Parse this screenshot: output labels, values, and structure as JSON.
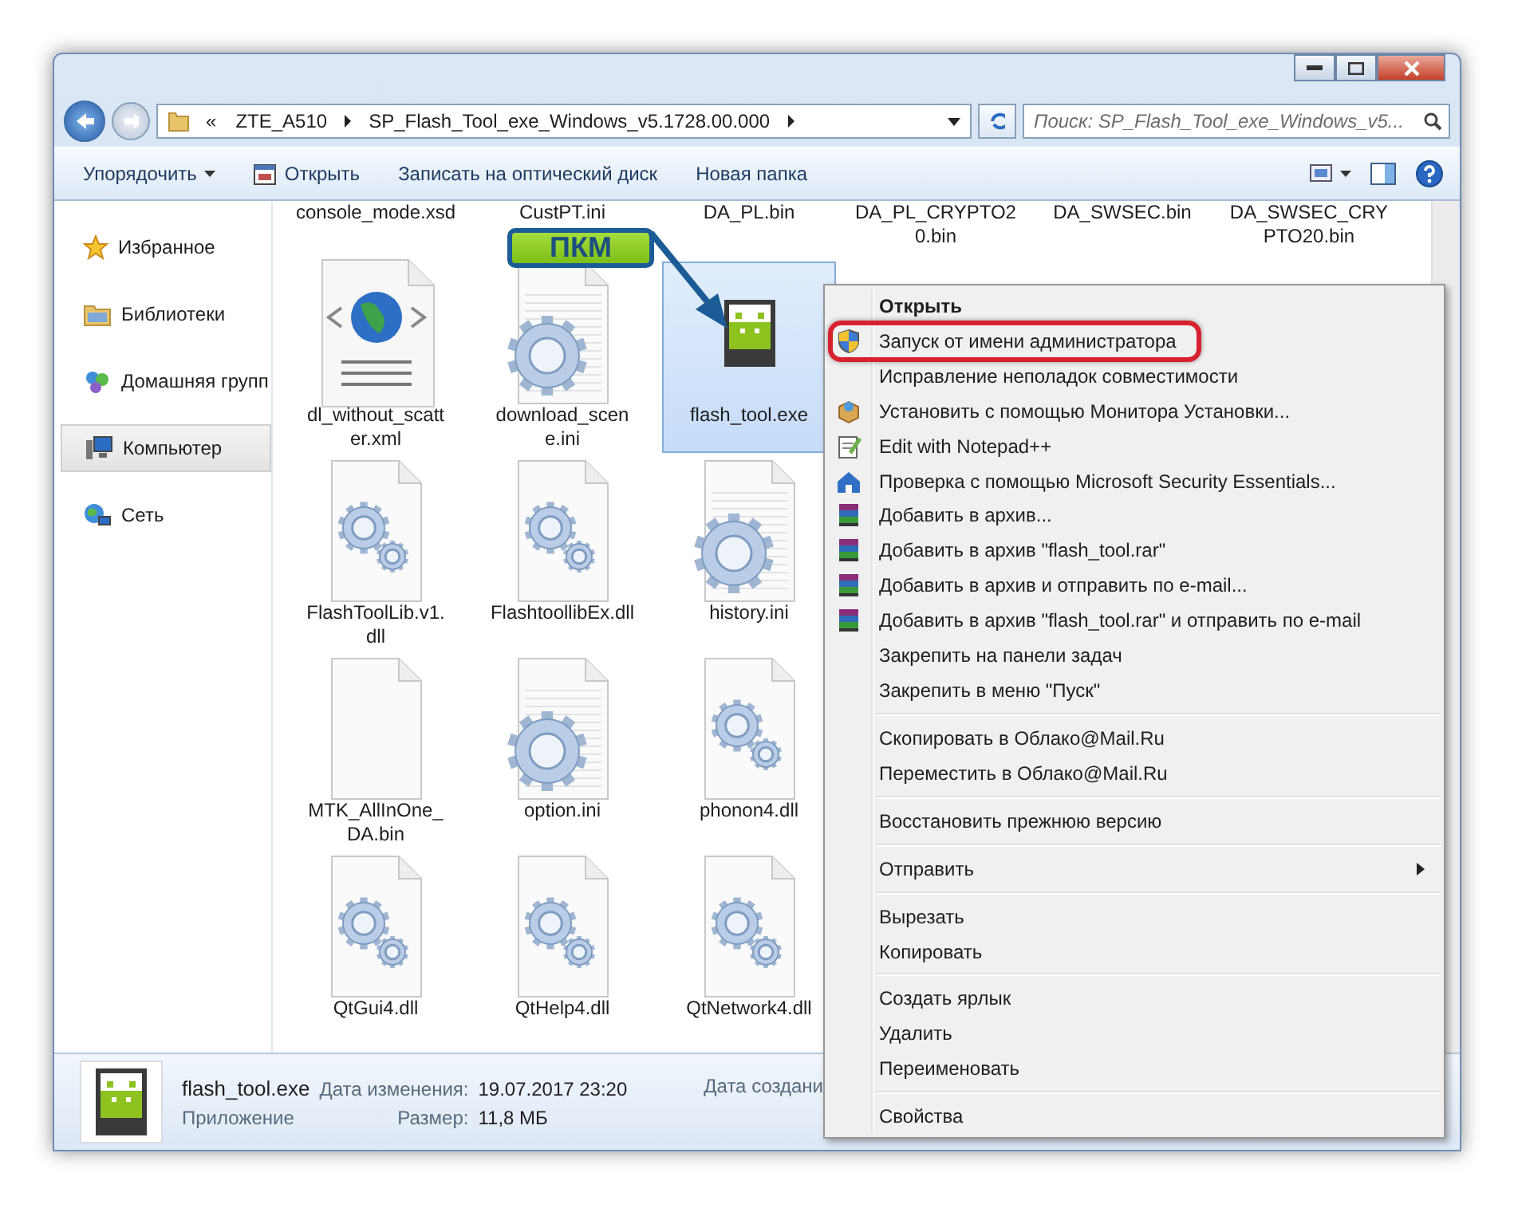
{
  "address_bar": {
    "overflow": "«",
    "crumbs": [
      "ZTE_A510",
      "SP_Flash_Tool_exe_Windows_v5.1728.00.000"
    ]
  },
  "search": {
    "placeholder": "Поиск: SP_Flash_Tool_exe_Windows_v5..."
  },
  "toolbar": {
    "items": [
      {
        "label": "Упорядочить",
        "kind": "menu"
      },
      {
        "label": "Открыть",
        "kind": "open"
      },
      {
        "label": "Записать на оптический диск",
        "kind": "plain"
      },
      {
        "label": "Новая папка",
        "kind": "plain"
      }
    ]
  },
  "sidebar": {
    "items": [
      {
        "label": "Избранное",
        "kind": "favorites",
        "selected": false
      },
      {
        "label": "Библиотеки",
        "kind": "libraries",
        "selected": false
      },
      {
        "label": "Домашняя групп",
        "kind": "homegroup",
        "selected": false
      },
      {
        "label": "Компьютер",
        "kind": "computer",
        "selected": true
      },
      {
        "label": "Сеть",
        "kind": "network",
        "selected": false
      }
    ]
  },
  "files": {
    "top_row": [
      "console_mode.xsd",
      "CustPT.ini",
      "DA_PL.bin",
      "DA_PL_CRYPTO20.bin",
      "DA_SWSEC.bin",
      "DA_SWSEC_CRYPTO20.bin"
    ],
    "items": [
      {
        "name": "dl_without_scatter.xml",
        "kind": "xml",
        "selected": false
      },
      {
        "name": "download_scene.ini",
        "kind": "settings",
        "selected": false
      },
      {
        "name": "flash_tool.exe",
        "kind": "exe",
        "selected": true
      },
      {
        "name": "FlashToolLib.v1.dll",
        "kind": "dll",
        "selected": false
      },
      {
        "name": "FlashtoollibEx.dll",
        "kind": "dll",
        "selected": false
      },
      {
        "name": "history.ini",
        "kind": "settings",
        "selected": false
      },
      {
        "name": "MTK_AllInOne_DA.bin",
        "kind": "blank",
        "selected": false
      },
      {
        "name": "option.ini",
        "kind": "settings",
        "selected": false
      },
      {
        "name": "phonon4.dll",
        "kind": "dll",
        "selected": false
      },
      {
        "name": "QtGui4.dll",
        "kind": "dll",
        "selected": false
      },
      {
        "name": "QtHelp4.dll",
        "kind": "dll",
        "selected": false
      },
      {
        "name": "QtNetwork4.dll",
        "kind": "dll",
        "selected": false
      }
    ]
  },
  "callout": {
    "label": "ПКМ"
  },
  "context_menu": [
    {
      "kind": "default",
      "label": "Открыть"
    },
    {
      "kind": "shielded",
      "label": "Запуск от имени администратора",
      "marked": true
    },
    {
      "kind": "item",
      "label": "Исправление неполадок совместимости"
    },
    {
      "kind": "installer",
      "label": "Установить с помощью Монитора Установки..."
    },
    {
      "kind": "editor",
      "label": "Edit with Notepad++"
    },
    {
      "kind": "antivirus",
      "label": "Проверка с помощью Microsoft Security Essentials..."
    },
    {
      "kind": "archiver",
      "label": "Добавить в архив..."
    },
    {
      "kind": "archiver",
      "label": "Добавить в архив \"flash_tool.rar\""
    },
    {
      "kind": "archiver",
      "label": "Добавить в архив и отправить по e-mail..."
    },
    {
      "kind": "archiver",
      "label": "Добавить в архив \"flash_tool.rar\" и отправить по e-mail"
    },
    {
      "kind": "item",
      "label": "Закрепить на панели задач"
    },
    {
      "kind": "item",
      "label": "Закрепить в меню \"Пуск\""
    },
    {
      "kind": "separator"
    },
    {
      "kind": "item",
      "label": "Скопировать в Облако@Mail.Ru"
    },
    {
      "kind": "item",
      "label": "Переместить в Облако@Mail.Ru"
    },
    {
      "kind": "separator"
    },
    {
      "kind": "item",
      "label": "Восстановить прежнюю версию"
    },
    {
      "kind": "separator"
    },
    {
      "kind": "submenu",
      "label": "Отправить"
    },
    {
      "kind": "separator"
    },
    {
      "kind": "item",
      "label": "Вырезать"
    },
    {
      "kind": "item",
      "label": "Копировать"
    },
    {
      "kind": "separator"
    },
    {
      "kind": "item",
      "label": "Создать ярлык"
    },
    {
      "kind": "item",
      "label": "Удалить"
    },
    {
      "kind": "item",
      "label": "Переименовать"
    },
    {
      "kind": "separator"
    },
    {
      "kind": "item",
      "label": "Свойства"
    }
  ],
  "status_bar": {
    "name": "flash_tool.exe",
    "type": "Приложение",
    "modified_label": "Дата изменения:",
    "modified": "19.07.2017 23:20",
    "size_label": "Размер:",
    "size": "11,8 МБ",
    "created_label": "Дата создани"
  }
}
